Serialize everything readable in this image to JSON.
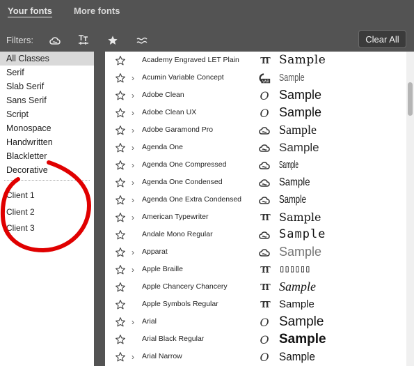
{
  "tabs": {
    "your_fonts": "Your fonts",
    "more_fonts": "More fonts"
  },
  "filters": {
    "label": "Filters:",
    "icons": [
      "creative-cloud-icon",
      "font-size-icon",
      "star-icon",
      "similar-icon"
    ],
    "clear_label": "Clear All"
  },
  "classes": {
    "items": [
      "All Classes",
      "Serif",
      "Slab Serif",
      "Sans Serif",
      "Script",
      "Monospace",
      "Handwritten",
      "Blackletter",
      "Decorative"
    ],
    "selected": "All Classes",
    "clients": [
      "Client 1",
      "Client 2",
      "Client 3"
    ]
  },
  "annotation_color": "#e00000",
  "fonts": [
    {
      "name": "Academy Engraved LET Plain",
      "has_chevron": false,
      "source": "truetype",
      "sample": "Sample"
    },
    {
      "name": "Acumin Variable Concept",
      "has_chevron": true,
      "source": "variable",
      "sample": "Sample"
    },
    {
      "name": "Adobe Clean",
      "has_chevron": true,
      "source": "opentype",
      "sample": "Sample"
    },
    {
      "name": "Adobe Clean UX",
      "has_chevron": true,
      "source": "opentype",
      "sample": "Sample"
    },
    {
      "name": "Adobe Garamond Pro",
      "has_chevron": true,
      "source": "creative-cloud",
      "sample": "Sample"
    },
    {
      "name": "Agenda One",
      "has_chevron": true,
      "source": "creative-cloud",
      "sample": "Sample"
    },
    {
      "name": "Agenda One Compressed",
      "has_chevron": true,
      "source": "creative-cloud",
      "sample": "Sample"
    },
    {
      "name": "Agenda One Condensed",
      "has_chevron": true,
      "source": "creative-cloud",
      "sample": "Sample"
    },
    {
      "name": "Agenda One Extra Condensed",
      "has_chevron": true,
      "source": "creative-cloud",
      "sample": "Sample"
    },
    {
      "name": "American Typewriter",
      "has_chevron": true,
      "source": "truetype",
      "sample": "Sample"
    },
    {
      "name": "Andale Mono Regular",
      "has_chevron": false,
      "source": "creative-cloud",
      "sample": "Sample"
    },
    {
      "name": "Apparat",
      "has_chevron": true,
      "source": "creative-cloud",
      "sample": "Sample"
    },
    {
      "name": "Apple Braille",
      "has_chevron": true,
      "source": "truetype",
      "sample": "▯▯▯▯▯▯"
    },
    {
      "name": "Apple Chancery Chancery",
      "has_chevron": false,
      "source": "truetype",
      "sample": "Sample"
    },
    {
      "name": "Apple Symbols Regular",
      "has_chevron": false,
      "source": "truetype",
      "sample": "Sample"
    },
    {
      "name": "Arial",
      "has_chevron": true,
      "source": "opentype",
      "sample": "Sample"
    },
    {
      "name": "Arial Black Regular",
      "has_chevron": false,
      "source": "opentype",
      "sample": "Sample"
    },
    {
      "name": "Arial Narrow",
      "has_chevron": true,
      "source": "opentype",
      "sample": "Sample"
    }
  ]
}
